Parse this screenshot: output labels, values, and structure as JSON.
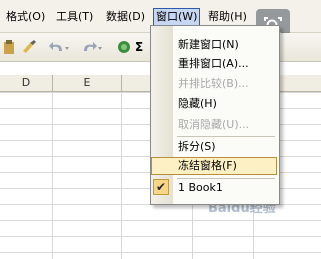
{
  "menubar": {
    "items": [
      "格式(O)",
      "工具(T)",
      "数据(D)",
      "窗口(W)",
      "帮助(H)"
    ]
  },
  "toolbar": {
    "sigma": "Σ"
  },
  "columns": [
    "D",
    "E",
    "F"
  ],
  "window_menu": {
    "items": [
      {
        "label": "新建窗口(N)",
        "enabled": true
      },
      {
        "label": "重排窗口(A)...",
        "enabled": true
      },
      {
        "label": "并排比较(B)...",
        "enabled": false
      },
      {
        "label": "隐藏(H)",
        "enabled": true
      },
      {
        "label": "取消隐藏(U)...",
        "enabled": false
      },
      {
        "label": "拆分(S)",
        "enabled": true
      },
      {
        "label": "冻结窗格(F)",
        "enabled": true,
        "highlighted": true
      },
      {
        "label": "1 Book1",
        "enabled": true,
        "checked": true
      }
    ],
    "check_mark": "✔"
  },
  "watermark": "Baidu经验",
  "colors": {
    "menubar_bg": "#f3f1ea",
    "highlight": "#fdf0c4",
    "open_menu": "#c7d7f2"
  }
}
